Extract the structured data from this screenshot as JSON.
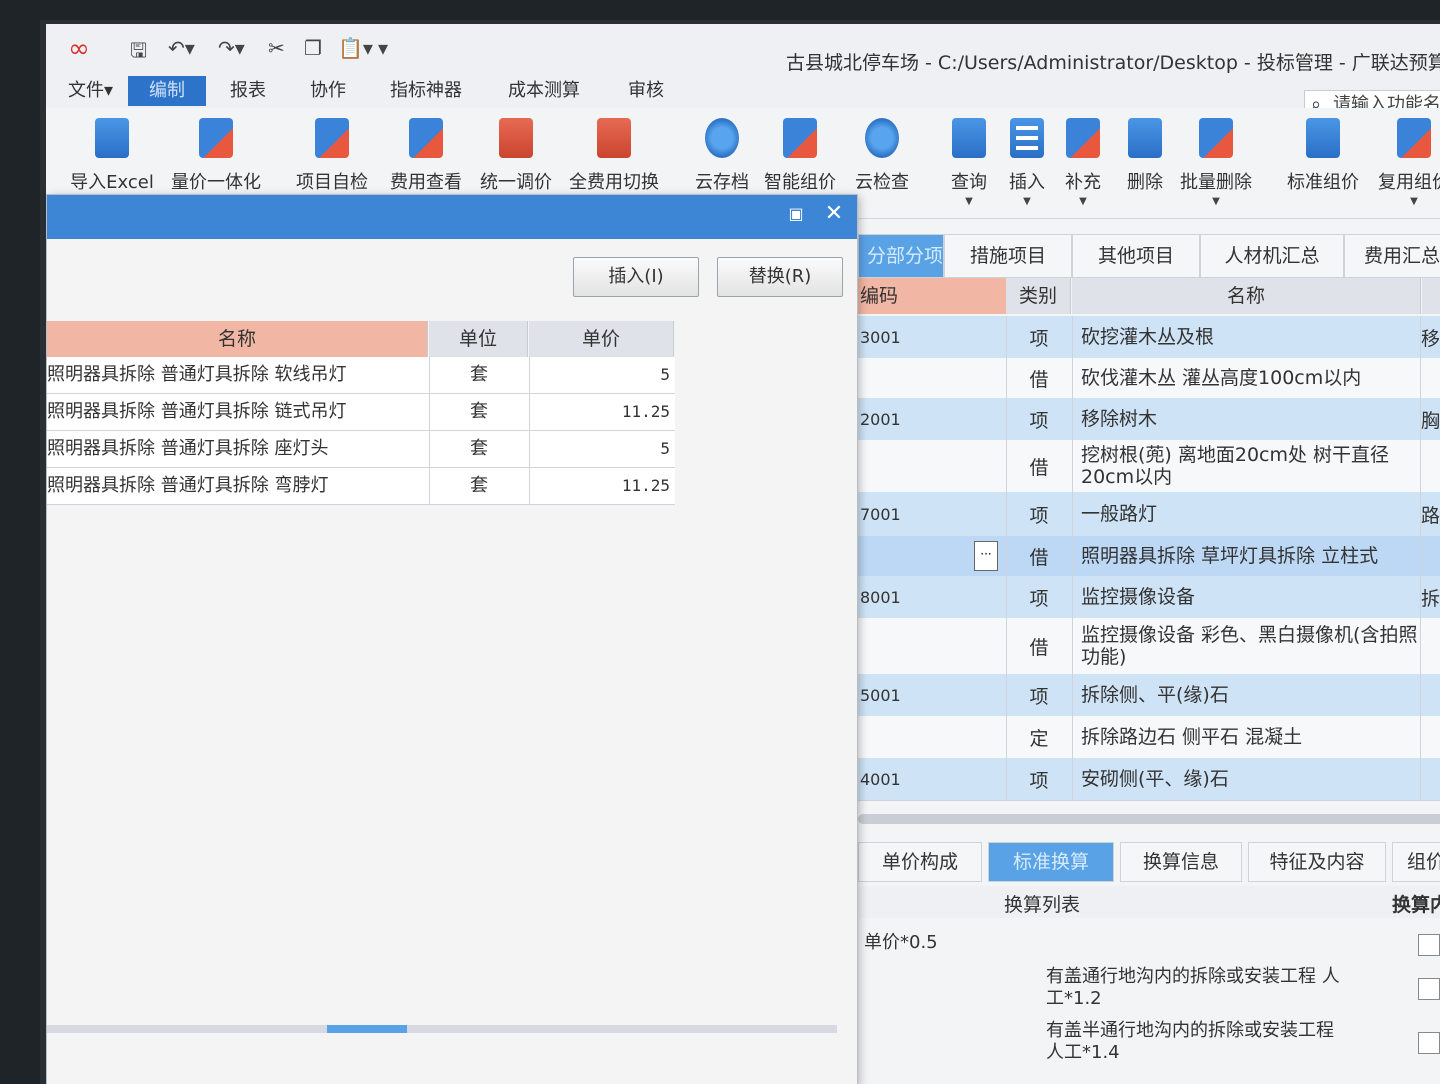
{
  "title": "古县城北停车场 - C:/Users/Administrator/Desktop - 投标管理 - 广联达预算",
  "menu": [
    "文件▾",
    "编制",
    "报表",
    "协作",
    "指标神器",
    "成本测算",
    "审核"
  ],
  "search": {
    "placeholder": "请输入功能名"
  },
  "toolbar": [
    "导入Excel",
    "量价一体化",
    "项目自检",
    "费用查看",
    "统一调价",
    "全费用切换",
    "云存档",
    "智能组价",
    "云检查",
    "查询",
    "插入",
    "补充",
    "删除",
    "批量删除",
    "标准组价",
    "复用组价"
  ],
  "tabs": [
    "分部分项",
    "措施项目",
    "其他项目",
    "人材机汇总",
    "费用汇总"
  ],
  "grid": {
    "headers": {
      "code": "编码",
      "kind": "类别",
      "name": "名称"
    },
    "rows": [
      {
        "code": "3001",
        "kind": "项",
        "name": "砍挖灌木丛及根",
        "extra": "移除",
        "style": "item"
      },
      {
        "code": "",
        "kind": "借",
        "name": "砍伐灌木丛 灌丛高度100cm以内",
        "extra": "",
        "style": "sub"
      },
      {
        "code": "2001",
        "kind": "项",
        "name": "移除树木",
        "extra": "胸",
        "style": "item"
      },
      {
        "code": "",
        "kind": "借",
        "name": "挖树根(蔸) 离地面20cm处 树干直径20cm以内",
        "extra": "",
        "style": "sub"
      },
      {
        "code": "7001",
        "kind": "项",
        "name": "一般路灯",
        "extra": "路",
        "style": "item"
      },
      {
        "code": "",
        "kind": "借",
        "name": "照明器具拆除 草坪灯具拆除 立柱式",
        "extra": "",
        "style": "sel"
      },
      {
        "code": "8001",
        "kind": "项",
        "name": "监控摄像设备",
        "extra": "拆",
        "style": "item"
      },
      {
        "code": "",
        "kind": "借",
        "name": "监控摄像设备 彩色、黑白摄像机(含拍照功能)",
        "extra": "",
        "style": "sub"
      },
      {
        "code": "5001",
        "kind": "项",
        "name": "拆除侧、平(缘)石",
        "extra": "",
        "style": "item"
      },
      {
        "code": "",
        "kind": "定",
        "name": "拆除路边石 侧平石 混凝土",
        "extra": "",
        "style": "sub"
      },
      {
        "code": "4001",
        "kind": "项",
        "name": "安砌侧(平、缘)石",
        "extra": "",
        "style": "item"
      }
    ]
  },
  "bottom_tabs": [
    "单价构成",
    "标准换算",
    "换算信息",
    "特征及内容",
    "组价"
  ],
  "conversion": {
    "header_list": "换算列表",
    "header_content": "换算内",
    "rows": [
      "单价*0.5",
      "有盖通行地沟内的拆除或安装工程 人工*1.2",
      "有盖半通行地沟内的拆除或安装工程 人工*1.4"
    ]
  },
  "dialog": {
    "insert_label": "插入(I)",
    "replace_label": "替换(R)",
    "headers": {
      "name": "名称",
      "unit": "单位",
      "price": "单价"
    },
    "rows": [
      {
        "name": "照明器具拆除 普通灯具拆除 软线吊灯",
        "unit": "套",
        "price": "5"
      },
      {
        "name": "照明器具拆除 普通灯具拆除 链式吊灯",
        "unit": "套",
        "price": "11.25"
      },
      {
        "name": "照明器具拆除 普通灯具拆除 座灯头",
        "unit": "套",
        "price": "5"
      },
      {
        "name": "照明器具拆除 普通灯具拆除 弯脖灯",
        "unit": "套",
        "price": "11.25"
      }
    ]
  }
}
